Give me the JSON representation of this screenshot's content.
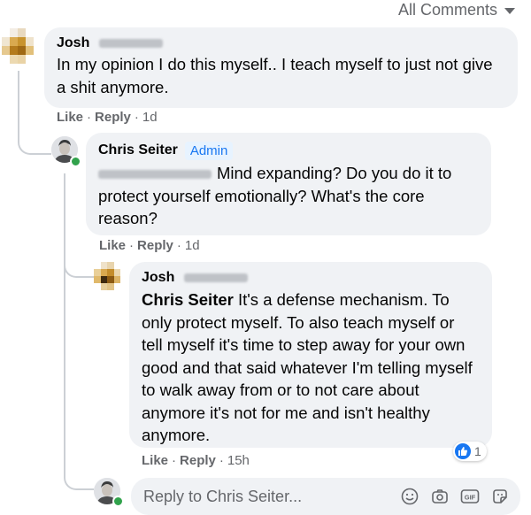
{
  "header": {
    "filter_label": "All Comments",
    "filter_icon": "chevron-down-icon"
  },
  "comments": [
    {
      "author": "Josh",
      "text": "In my opinion I do this myself.. I teach myself to just not give a shit anymore.",
      "actions": {
        "like": "Like",
        "reply": "Reply",
        "time": "1d"
      }
    },
    {
      "author": "Chris Seiter",
      "badge": "Admin",
      "text": "Mind expanding? Do you do it to protect yourself emotionally? What's the core reason?",
      "actions": {
        "like": "Like",
        "reply": "Reply",
        "time": "1d"
      }
    },
    {
      "author": "Josh",
      "mention": "Chris Seiter",
      "text": "It's a defense mechanism. To only protect myself. To also teach myself or tell myself it's time to step away for your own good and that said whatever I'm telling myself to walk away from or to not care about anymore it's not for me and isn't healthy anymore.",
      "actions": {
        "like": "Like",
        "reply": "Reply",
        "time": "15h"
      },
      "reaction": {
        "icon": "thumbs-up-icon",
        "count": "1"
      }
    }
  ],
  "reply_box": {
    "placeholder": "Reply to Chris Seiter...",
    "icons": [
      "emoji-icon",
      "camera-icon",
      "gif-icon",
      "sticker-icon"
    ]
  },
  "colors": {
    "accent": "#1877f2",
    "bubble": "#f0f2f5",
    "muted": "#65676b",
    "online": "#31a24c"
  }
}
